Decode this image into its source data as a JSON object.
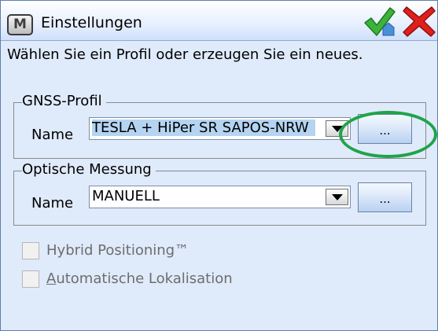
{
  "window": {
    "menu_glyph": "M",
    "title": "Einstellungen"
  },
  "instruction": "Wählen Sie ein Profil oder erzeugen Sie ein neues.",
  "gnss_group": {
    "title": "GNSS-Profil",
    "name_label": "Name",
    "selected_value": "TESLA + HiPer SR SAPOS-NRW",
    "browse_label": "..."
  },
  "optical_group": {
    "title": "Optische Messung",
    "name_label": "Name",
    "selected_value": "MANUELL",
    "browse_label": "..."
  },
  "options": {
    "hybrid_label": "Hybrid Positioning™",
    "hybrid_checked": false,
    "lokalisation_label": "Automatische Lokalisation",
    "lokalisation_checked": false
  },
  "colors": {
    "background": "#dfeafb",
    "highlight_ring": "#1fa449",
    "confirm_green": "#3db33a",
    "cancel_red": "#e0201b"
  },
  "icons": {
    "menu": "menu-icon",
    "confirm": "green-checkmark-icon",
    "cancel": "red-x-icon",
    "dropdown": "chevron-down-icon"
  }
}
